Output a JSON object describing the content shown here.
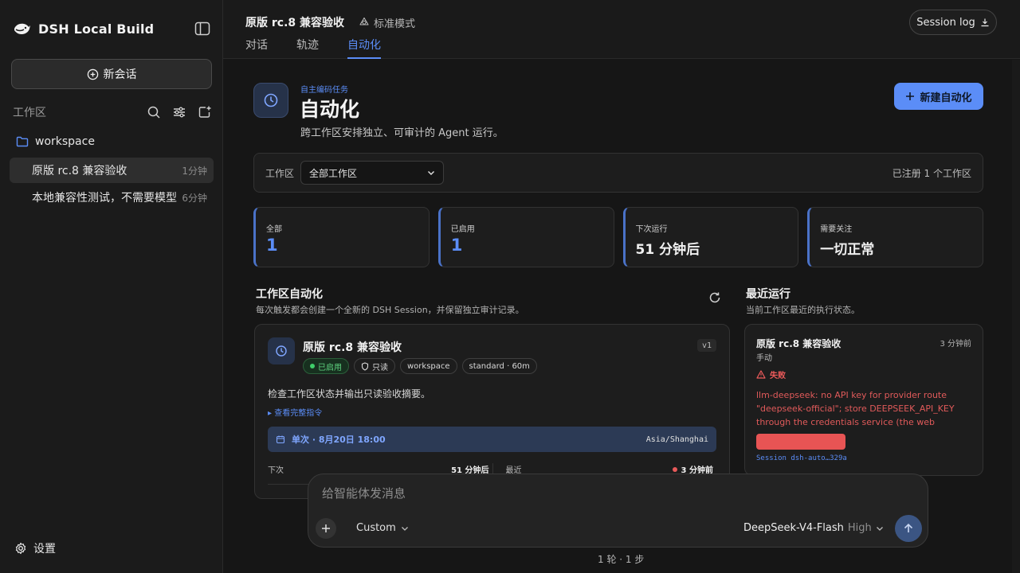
{
  "sidebar": {
    "brand": "DSH Local Build",
    "new_chat": "新会话",
    "workspace_header": "工作区",
    "workspace_name": "workspace",
    "conversations": [
      {
        "title": "原版 rc.8 兼容验收",
        "age": "1分钟",
        "active": true
      },
      {
        "title": "本地兼容性测试，不需要模型",
        "age": "6分钟",
        "active": false
      }
    ],
    "settings": "设置"
  },
  "header": {
    "title": "原版 rc.8 兼容验收",
    "mode": "标准模式",
    "tabs": [
      "对话",
      "轨迹",
      "自动化"
    ],
    "active_tab": "自动化",
    "session_log": "Session log"
  },
  "hero": {
    "kicker": "自主编码任务",
    "title": "自动化",
    "subtitle": "跨工作区安排独立、可审计的 Agent 运行。",
    "new_button": "新建自动化"
  },
  "filter": {
    "label": "工作区",
    "selected": "全部工作区",
    "registered": "已注册 1 个工作区"
  },
  "stats": [
    {
      "label": "全部",
      "value": "1",
      "numeric": true
    },
    {
      "label": "已启用",
      "value": "1",
      "numeric": true
    },
    {
      "label": "下次运行",
      "value": "51 分钟后",
      "numeric": false
    },
    {
      "label": "需要关注",
      "value": "一切正常",
      "numeric": false
    }
  ],
  "section": {
    "title": "工作区自动化",
    "subtitle": "每次触发都会创建一个全新的 DSH Session，并保留独立审计记录。"
  },
  "automation": {
    "name": "原版 rc.8 兼容验收",
    "version": "v1",
    "chips": {
      "enabled": "已启用",
      "readonly": "只读",
      "workspace": "workspace",
      "profile": "standard · 60m"
    },
    "description": "检查工作区状态并输出只读验收摘要。",
    "more": "▸ 查看完整指令",
    "schedule": "单次 · 8月20日 18:00",
    "timezone": "Asia/Shanghai",
    "next_label": "下次",
    "next_value": "51 分钟后",
    "last_label": "最近",
    "last_value": "3 分钟前"
  },
  "recent": {
    "title": "最近运行",
    "subtitle": "当前工作区最近的执行状态。",
    "run": {
      "name": "原版 rc.8 兼容验收",
      "age": "3 分钟前",
      "kind": "手动",
      "status": "失败",
      "error": "llm-deepseek: no API key for provider route \"deepseek-official\"; store DEEPSEEK_API_KEY through the credentials service (the web Models…",
      "session": "Session dsh-auto…329a"
    }
  },
  "composer": {
    "placeholder": "给智能体发消息",
    "custom": "Custom",
    "model": "DeepSeek-V4-Flash",
    "level": "High",
    "turns": "1 轮 · 1 步"
  },
  "colors": {
    "accent": "#5b8df7",
    "success": "#3fce6a",
    "error": "#e85454",
    "background": "#161616"
  }
}
